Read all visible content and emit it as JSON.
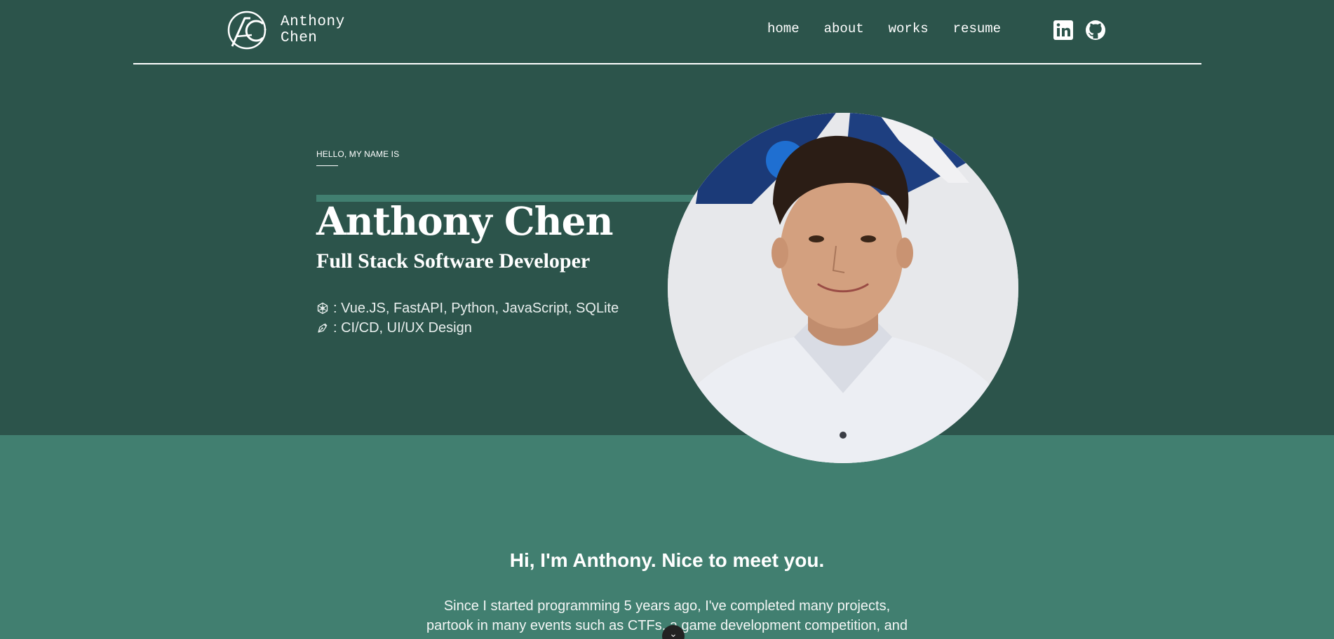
{
  "brand": {
    "first": "Anthony",
    "last": "Chen"
  },
  "nav": [
    {
      "label": "home"
    },
    {
      "label": "about"
    },
    {
      "label": "works"
    },
    {
      "label": "resume"
    }
  ],
  "social": [
    {
      "icon": "linkedin-icon"
    },
    {
      "icon": "github-icon"
    }
  ],
  "hero": {
    "eyebrow": "HELLO, MY NAME IS",
    "name": "Anthony Chen",
    "role": "Full Stack Software Developer",
    "skills": [
      {
        "icon": "code-icon",
        "text": ": Vue.JS, FastAPI, Python, JavaScript, SQLite"
      },
      {
        "icon": "pen-icon",
        "text": ": CI/CD, UI/UX Design"
      }
    ]
  },
  "about": {
    "greeting": "Hi, I'm Anthony. Nice to meet you.",
    "intro": "Since I started programming 5 years ago, I've completed many projects, partook in many events such as CTFs, a game development competition, and"
  },
  "colors": {
    "dark_bg": "#2c544b",
    "accent": "#417f70",
    "text": "#ffffff"
  }
}
